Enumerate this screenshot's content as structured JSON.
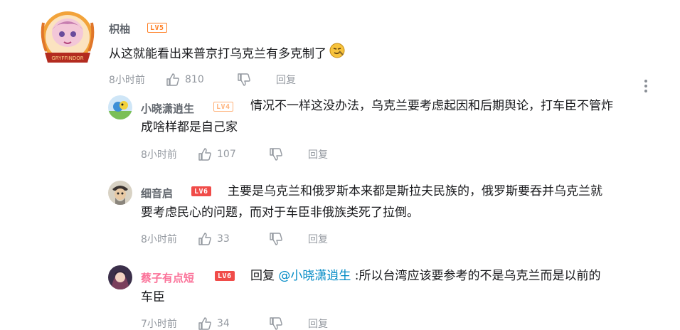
{
  "main_comment": {
    "username": "枳柚",
    "level": "LV5",
    "avatar_text": "GRYFFINDOR",
    "content": "从这就能看出来普京打乌克兰有多克制了",
    "emoji": "doge-emoji",
    "time": "8小时前",
    "likes": "810",
    "reply_label": "回复"
  },
  "replies": [
    {
      "username": "小晓潇逍生",
      "level": "LV4",
      "content_line1": "情况不一样这没办法，乌克兰要考虑起因和后期舆论，打车臣不管炸",
      "content_line2": "成啥样都是自己家",
      "time": "8小时前",
      "likes": "107",
      "reply_label": "回复"
    },
    {
      "username": "细音启",
      "level": "LV6",
      "content_line1": "主要是乌克兰和俄罗斯本来都是斯拉夫民族的，俄罗斯要吞并乌克兰就",
      "content_line2": "要考虑民心的问题，而对于车臣非俄族类死了拉倒。",
      "time": "8小时前",
      "likes": "33",
      "reply_label": "回复"
    },
    {
      "username": "蔡子有点短",
      "level": "LV6",
      "reply_prefix": "回复 ",
      "mention": "@小晓潇逍生",
      "content_line1": " :所以台湾应该要参考的不是乌克兰而是以前的",
      "content_line2": "车臣",
      "time": "7小时前",
      "likes": "34",
      "reply_label": "回复"
    }
  ],
  "colors": {
    "accent_link": "#008ac5",
    "pink_name": "#fb7299",
    "meta_gray": "#9499a0",
    "level_red": "#f04c49",
    "level_orange": "#ff7f24"
  }
}
